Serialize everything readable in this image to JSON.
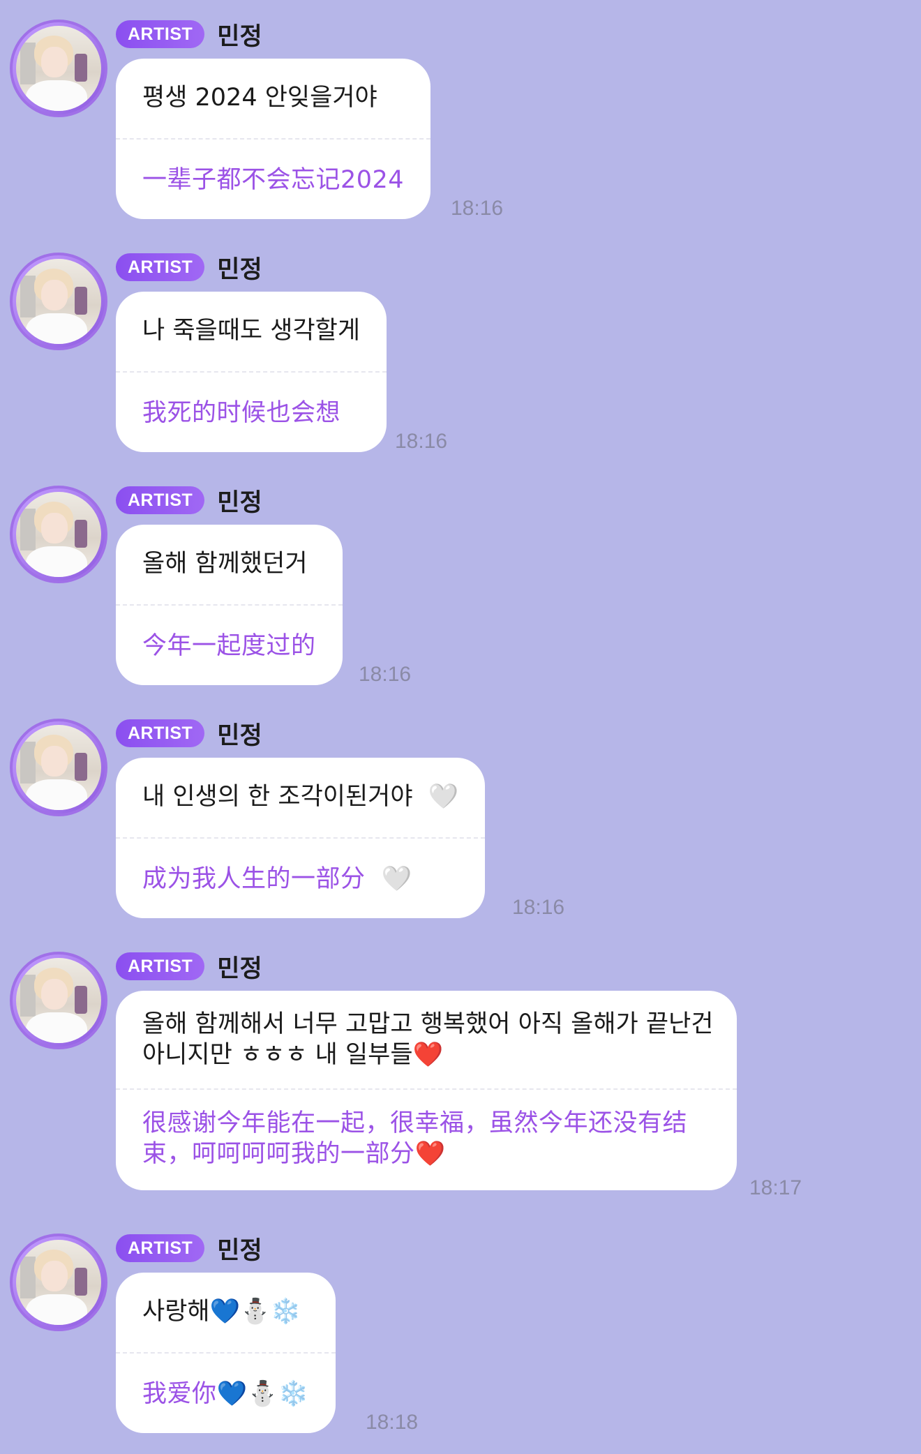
{
  "messages": [
    {
      "badge": "ARTIST",
      "name": "민정",
      "ko": "평생 2024 안잊을거야",
      "zh": "一辈子都不会忘记2024",
      "time": "18:16"
    },
    {
      "badge": "ARTIST",
      "name": "민정",
      "ko": "나 죽을때도 생각할게",
      "zh": "我死的时候也会想",
      "time": "18:16"
    },
    {
      "badge": "ARTIST",
      "name": "민정",
      "ko": "올해 함께했던거",
      "zh": "今年一起度过的",
      "time": "18:16"
    },
    {
      "badge": "ARTIST",
      "name": "민정",
      "ko": "내 인생의 한 조각이된거야  🤍",
      "zh": "成为我人生的一部分  🤍",
      "time": "18:16"
    },
    {
      "badge": "ARTIST",
      "name": "민정",
      "ko_lines": [
        "올해 함께해서 너무 고맙고 행복했어 아직 올해가 끝난건",
        "아니지만 ㅎㅎㅎ 내 일부들❤️"
      ],
      "zh_lines": [
        "很感谢今年能在一起，很幸福，虽然今年还没有结",
        "束，呵呵呵呵我的一部分❤️"
      ],
      "time": "18:17"
    },
    {
      "badge": "ARTIST",
      "name": "민정",
      "ko": "사랑해💙⛄❄️",
      "zh": "我爱你💙⛄❄️",
      "time": "18:18"
    }
  ]
}
